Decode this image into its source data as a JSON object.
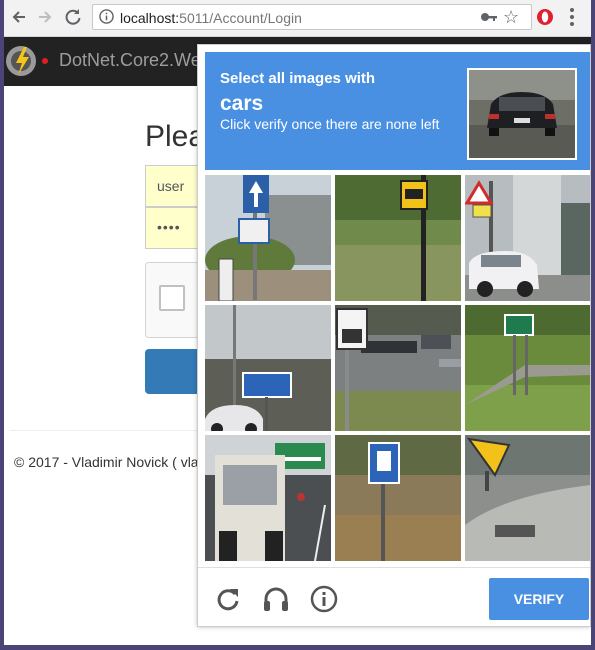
{
  "browser": {
    "url_host": "localhost:",
    "url_path": "5011/Account/Login"
  },
  "site": {
    "brand": "DotNet.Core2.We"
  },
  "login": {
    "heading": "Plea",
    "username_value": "user",
    "password_value": "••••"
  },
  "footer": {
    "text": "© 2017 - Vladimir Novick ( vla"
  },
  "challenge": {
    "line1": "Select all images with",
    "keyword": "cars",
    "instruction": "Click verify once there are none left",
    "verify_label": "VERIFY",
    "accent_color": "#4a90e2",
    "tiles": [
      "road sign with bushes",
      "speed sign on grass",
      "warning sign with white car",
      "blue sign over wall with car",
      "speed limit 35 parking lot",
      "green road sign on grass",
      "white truck on highway",
      "blue parking sign field",
      "yellow sign on curb"
    ],
    "footer_icons": [
      "reload-icon",
      "audio-icon",
      "info-icon"
    ]
  }
}
